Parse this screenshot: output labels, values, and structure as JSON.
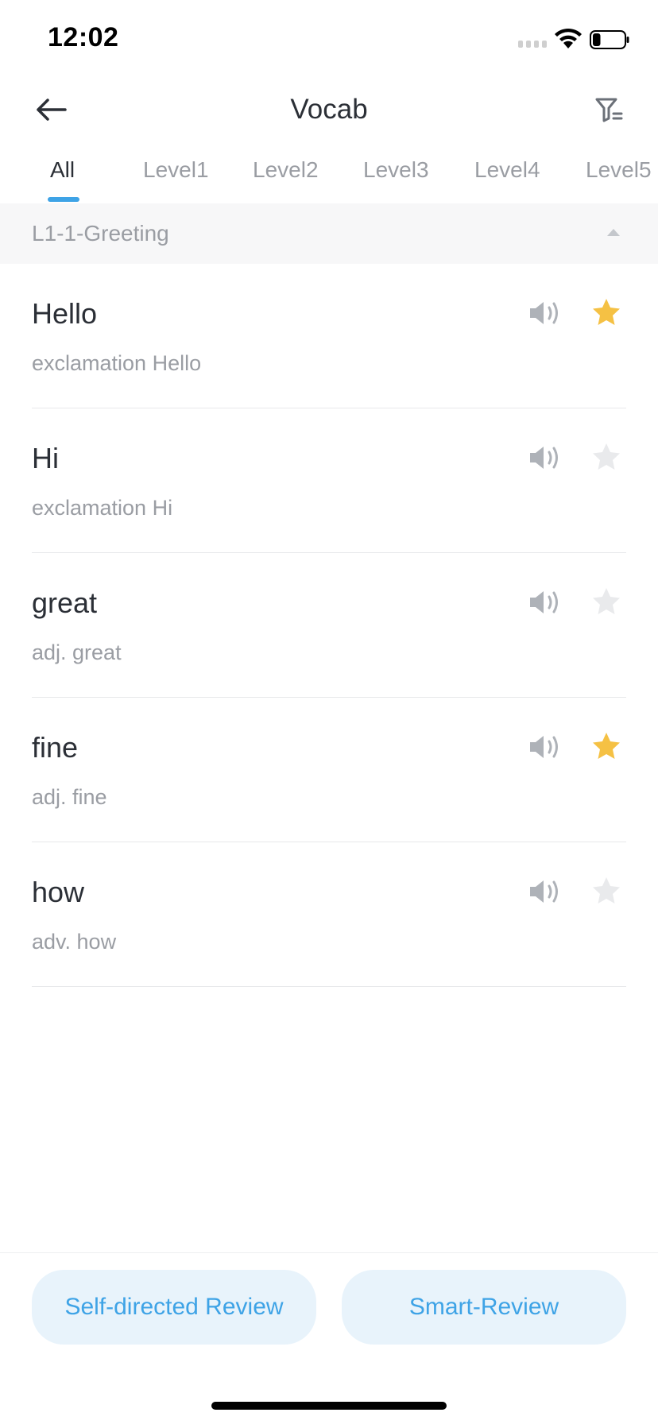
{
  "status_bar": {
    "time": "12:02",
    "battery_level": 0.25
  },
  "nav": {
    "title": "Vocab",
    "back_icon": "arrow-left-icon",
    "filter_icon": "filter-icon"
  },
  "tabs": [
    {
      "label": "All",
      "active": true
    },
    {
      "label": "Level1",
      "active": false
    },
    {
      "label": "Level2",
      "active": false
    },
    {
      "label": "Level3",
      "active": false
    },
    {
      "label": "Level4",
      "active": false
    },
    {
      "label": "Level5",
      "active": false
    }
  ],
  "section": {
    "title": "L1-1-Greeting",
    "expanded": true
  },
  "vocab": [
    {
      "word": "Hello",
      "definition": "exclamation Hello",
      "starred": true
    },
    {
      "word": "Hi",
      "definition": "exclamation Hi",
      "starred": false
    },
    {
      "word": "great",
      "definition": "adj. great",
      "starred": false
    },
    {
      "word": "fine",
      "definition": "adj. fine",
      "starred": true
    },
    {
      "word": "how",
      "definition": "adv. how",
      "starred": false
    }
  ],
  "buttons": {
    "self_review": "Self-directed Review",
    "smart_review": "Smart-Review"
  },
  "colors": {
    "accent": "#3ea3e6",
    "star_on": "#f5c144",
    "star_off": "#e9eaec",
    "speaker": "#aeb2b8"
  }
}
